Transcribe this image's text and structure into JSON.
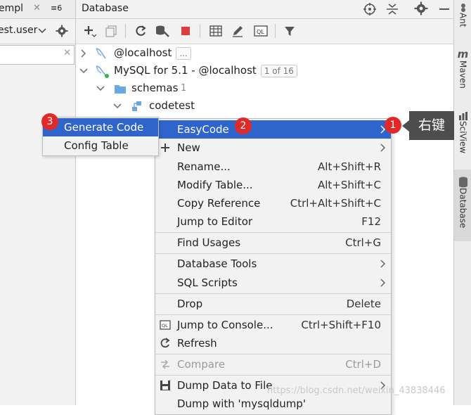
{
  "left": {
    "tab_text": "empl",
    "tab_badge": "≡6",
    "file_text": "est.user"
  },
  "db": {
    "title": "Database"
  },
  "tree": [
    {
      "label": "@localhost",
      "badge": "..."
    },
    {
      "label": "MySQL for 5.1 - @localhost",
      "badge": "1 of 16"
    },
    {
      "label": "schemas",
      "count": "1"
    },
    {
      "label": "codetest"
    }
  ],
  "right_tabs": {
    "ant": "Ant",
    "maven": "Maven",
    "sciview": "SciView",
    "database": "Database"
  },
  "submenu": {
    "items": [
      "Generate Code",
      "Config Table"
    ]
  },
  "menu": {
    "items": [
      {
        "label": "EasyCode",
        "shortcut": "",
        "submenu": true
      },
      {
        "label": "New",
        "shortcut": "",
        "submenu": true
      },
      {
        "label": "Rename...",
        "shortcut": "Alt+Shift+R"
      },
      {
        "label": "Modify Table...",
        "shortcut": "Alt+Shift+C"
      },
      {
        "label": "Copy Reference",
        "shortcut": "Ctrl+Alt+Shift+C"
      },
      {
        "label": "Jump to Editor",
        "shortcut": "F12"
      },
      {
        "label": "Find Usages",
        "shortcut": "Ctrl+G"
      },
      {
        "label": "Database Tools",
        "shortcut": "",
        "submenu": true
      },
      {
        "label": "SQL Scripts",
        "shortcut": "",
        "submenu": true
      },
      {
        "label": "Drop",
        "shortcut": "Delete"
      },
      {
        "label": "Jump to Console...",
        "shortcut": "Ctrl+Shift+F10"
      },
      {
        "label": "Refresh",
        "shortcut": ""
      },
      {
        "label": "Compare",
        "shortcut": "Ctrl+D"
      },
      {
        "label": "Dump Data to File",
        "shortcut": "",
        "submenu": true
      },
      {
        "label": "Dump with 'mysqldump'",
        "shortcut": ""
      }
    ]
  },
  "annotations": {
    "step1": "1",
    "step2": "2",
    "step3": "3",
    "callout": "右键"
  },
  "watermark": "https://blog.csdn.net/weixin_43838446",
  "colors": {
    "highlight": "#2f65ca",
    "accent_red": "#e02a2a",
    "folder_blue": "#6aa8e0"
  }
}
